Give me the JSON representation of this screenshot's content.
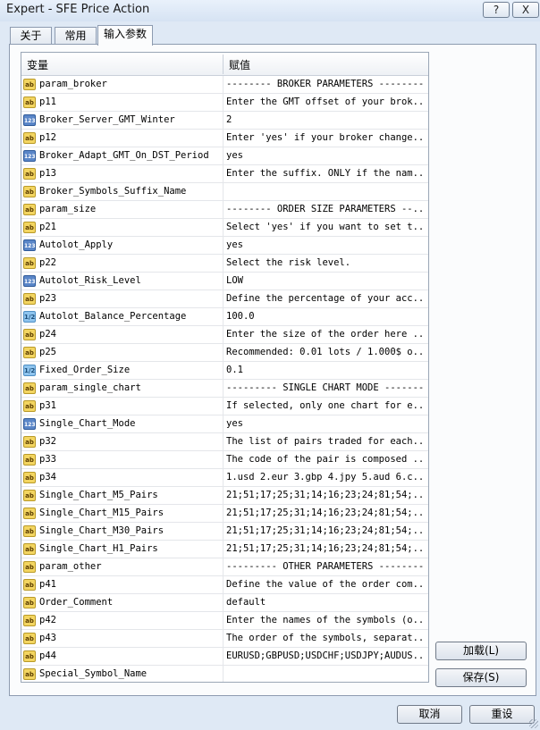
{
  "window": {
    "title": "Expert - SFE Price Action",
    "help_label": "?",
    "close_label": "X"
  },
  "tabs": [
    {
      "label": "关于"
    },
    {
      "label": "常用"
    },
    {
      "label": "输入参数"
    }
  ],
  "grid": {
    "col_variable": "变量",
    "col_value": "赋值",
    "rows": [
      {
        "icon": "ab",
        "name": "param_broker",
        "value": "-------- BROKER PARAMETERS --------"
      },
      {
        "icon": "ab",
        "name": "p11",
        "value": "Enter the GMT offset of your brok..."
      },
      {
        "icon": "123",
        "name": "Broker_Server_GMT_Winter",
        "value": "2"
      },
      {
        "icon": "ab",
        "name": "p12",
        "value": "Enter 'yes' if your broker change..."
      },
      {
        "icon": "123",
        "name": "Broker_Adapt_GMT_On_DST_Period",
        "value": "yes"
      },
      {
        "icon": "ab",
        "name": "p13",
        "value": "Enter the suffix. ONLY if the nam..."
      },
      {
        "icon": "ab",
        "name": "Broker_Symbols_Suffix_Name",
        "value": ""
      },
      {
        "icon": "ab",
        "name": "param_size",
        "value": "-------- ORDER SIZE PARAMETERS --..."
      },
      {
        "icon": "ab",
        "name": "p21",
        "value": "Select 'yes' if you want to set t..."
      },
      {
        "icon": "123",
        "name": "Autolot_Apply",
        "value": "yes"
      },
      {
        "icon": "ab",
        "name": "p22",
        "value": "Select the risk level."
      },
      {
        "icon": "123",
        "name": "Autolot_Risk_Level",
        "value": "LOW"
      },
      {
        "icon": "ab",
        "name": "p23",
        "value": "Define the percentage of your acc..."
      },
      {
        "icon": "1/2",
        "name": "Autolot_Balance_Percentage",
        "value": "100.0"
      },
      {
        "icon": "ab",
        "name": "p24",
        "value": "Enter the size of the order here ..."
      },
      {
        "icon": "ab",
        "name": "p25",
        "value": "Recommended: 0.01 lots / 1.000$ o..."
      },
      {
        "icon": "1/2",
        "name": "Fixed_Order_Size",
        "value": "0.1"
      },
      {
        "icon": "ab",
        "name": "param_single_chart",
        "value": "--------- SINGLE CHART MODE --------"
      },
      {
        "icon": "ab",
        "name": "p31",
        "value": "If selected, only one chart for e..."
      },
      {
        "icon": "123",
        "name": "Single_Chart_Mode",
        "value": "yes"
      },
      {
        "icon": "ab",
        "name": "p32",
        "value": "The list of pairs traded for each..."
      },
      {
        "icon": "ab",
        "name": "p33",
        "value": "The code of the pair is composed ..."
      },
      {
        "icon": "ab",
        "name": "p34",
        "value": "1.usd 2.eur 3.gbp 4.jpy 5.aud 6.c..."
      },
      {
        "icon": "ab",
        "name": "Single_Chart_M5_Pairs",
        "value": "21;51;17;25;31;14;16;23;24;81;54;..."
      },
      {
        "icon": "ab",
        "name": "Single_Chart_M15_Pairs",
        "value": "21;51;17;25;31;14;16;23;24;81;54;..."
      },
      {
        "icon": "ab",
        "name": "Single_Chart_M30_Pairs",
        "value": "21;51;17;25;31;14;16;23;24;81;54;..."
      },
      {
        "icon": "ab",
        "name": "Single_Chart_H1_Pairs",
        "value": "21;51;17;25;31;14;16;23;24;81;54;..."
      },
      {
        "icon": "ab",
        "name": "param_other",
        "value": "--------- OTHER PARAMETERS --------"
      },
      {
        "icon": "ab",
        "name": "p41",
        "value": "Define the value of the order com..."
      },
      {
        "icon": "ab",
        "name": "Order_Comment",
        "value": "default"
      },
      {
        "icon": "ab",
        "name": "p42",
        "value": "Enter the names of the symbols (o..."
      },
      {
        "icon": "ab",
        "name": "p43",
        "value": "The order of the symbols, separat..."
      },
      {
        "icon": "ab",
        "name": "p44",
        "value": "EURUSD;GBPUSD;USDCHF;USDJPY;AUDUS..."
      },
      {
        "icon": "ab",
        "name": "Special_Symbol_Name",
        "value": ""
      }
    ]
  },
  "buttons": {
    "load": "加载(L)",
    "save": "保存(S)",
    "cancel": "取消",
    "reset": "重设"
  }
}
